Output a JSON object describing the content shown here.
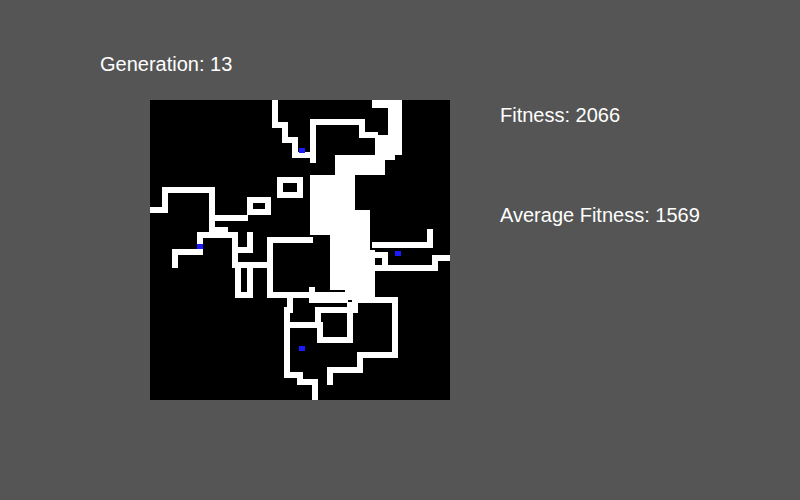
{
  "header": {
    "generation": "Generation: 13"
  },
  "stats": [
    {
      "label": "Fitness: 2066"
    },
    {
      "label": "Average Fitness: 1569"
    }
  ]
}
